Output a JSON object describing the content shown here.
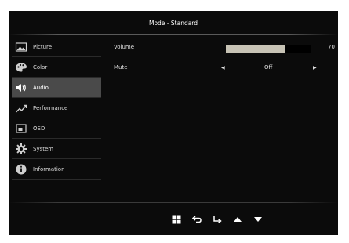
{
  "osd": {
    "title": "Mode - Standard",
    "menu": [
      {
        "label": "Picture",
        "icon": "picture-icon",
        "active": false
      },
      {
        "label": "Color",
        "icon": "palette-icon",
        "active": false
      },
      {
        "label": "Audio",
        "icon": "speaker-icon",
        "active": true
      },
      {
        "label": "Performance",
        "icon": "trend-up-icon",
        "active": false
      },
      {
        "label": "OSD",
        "icon": "osd-window-icon",
        "active": false
      },
      {
        "label": "System",
        "icon": "gear-icon",
        "active": false
      },
      {
        "label": "Information",
        "icon": "info-icon",
        "active": false
      }
    ],
    "settings": {
      "volume": {
        "label": "Volume",
        "value": "70",
        "percent": 70
      },
      "mute": {
        "label": "Mute",
        "value": "Off"
      }
    },
    "nav_buttons": [
      "menu-grid-icon",
      "back-arrow-icon",
      "enter-arrow-icon",
      "up-arrow-icon",
      "down-arrow-icon"
    ],
    "colors": {
      "background": "#0b0b0b",
      "active_item": "#4a4a4a",
      "volume_fill": "#c7c3b5"
    }
  }
}
